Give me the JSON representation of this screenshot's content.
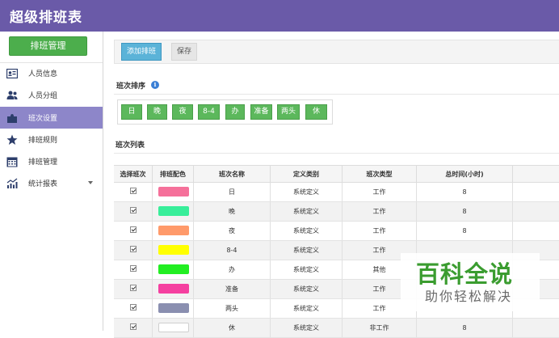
{
  "app": {
    "title": "超级排班表"
  },
  "sidebar": {
    "header_button": "排班管理",
    "items": [
      {
        "label": "人员信息",
        "icon": "id-card-icon",
        "active": false
      },
      {
        "label": "人员分组",
        "icon": "users-icon",
        "active": false
      },
      {
        "label": "班次设置",
        "icon": "puzzle-icon",
        "active": true
      },
      {
        "label": "排班规则",
        "icon": "star-icon",
        "active": false
      },
      {
        "label": "排班管理",
        "icon": "calendar-icon",
        "active": false
      },
      {
        "label": "统计报表",
        "icon": "chart-icon",
        "active": false,
        "has_dropdown": true
      }
    ],
    "active_color": "#8d86c9"
  },
  "toolbar": {
    "add_label": "添加排班",
    "save_label": "保存"
  },
  "shift_order": {
    "title": "班次排序",
    "chips": [
      "日",
      "晚",
      "夜",
      "8-4",
      "办",
      "准备",
      "两头",
      "休"
    ]
  },
  "shift_list": {
    "title": "班次列表",
    "columns": [
      "选择班次",
      "排班配色",
      "班次名称",
      "定义类别",
      "班次类型",
      "总时间(小时)"
    ],
    "rows": [
      {
        "checked": true,
        "color": "#f5709a",
        "name": "日",
        "category": "系统定义",
        "type": "工作",
        "hours": "8"
      },
      {
        "checked": true,
        "color": "#38ee9a",
        "name": "晚",
        "category": "系统定义",
        "type": "工作",
        "hours": "8"
      },
      {
        "checked": true,
        "color": "#ff9a6a",
        "name": "夜",
        "category": "系统定义",
        "type": "工作",
        "hours": "8"
      },
      {
        "checked": true,
        "color": "#ffff00",
        "name": "8-4",
        "category": "系统定义",
        "type": "工作",
        "hours": ""
      },
      {
        "checked": true,
        "color": "#22ee22",
        "name": "办",
        "category": "系统定义",
        "type": "其他",
        "hours": ""
      },
      {
        "checked": true,
        "color": "#f540a0",
        "name": "准备",
        "category": "系统定义",
        "type": "工作",
        "hours": ""
      },
      {
        "checked": true,
        "color": "#8a8fb0",
        "name": "两头",
        "category": "系统定义",
        "type": "工作",
        "hours": ""
      },
      {
        "checked": true,
        "color": "#ffffff",
        "name": "休",
        "category": "系统定义",
        "type": "非工作",
        "hours": "8"
      }
    ]
  },
  "watermark": {
    "title": "百科全说",
    "subtitle": "助你轻松解决"
  }
}
